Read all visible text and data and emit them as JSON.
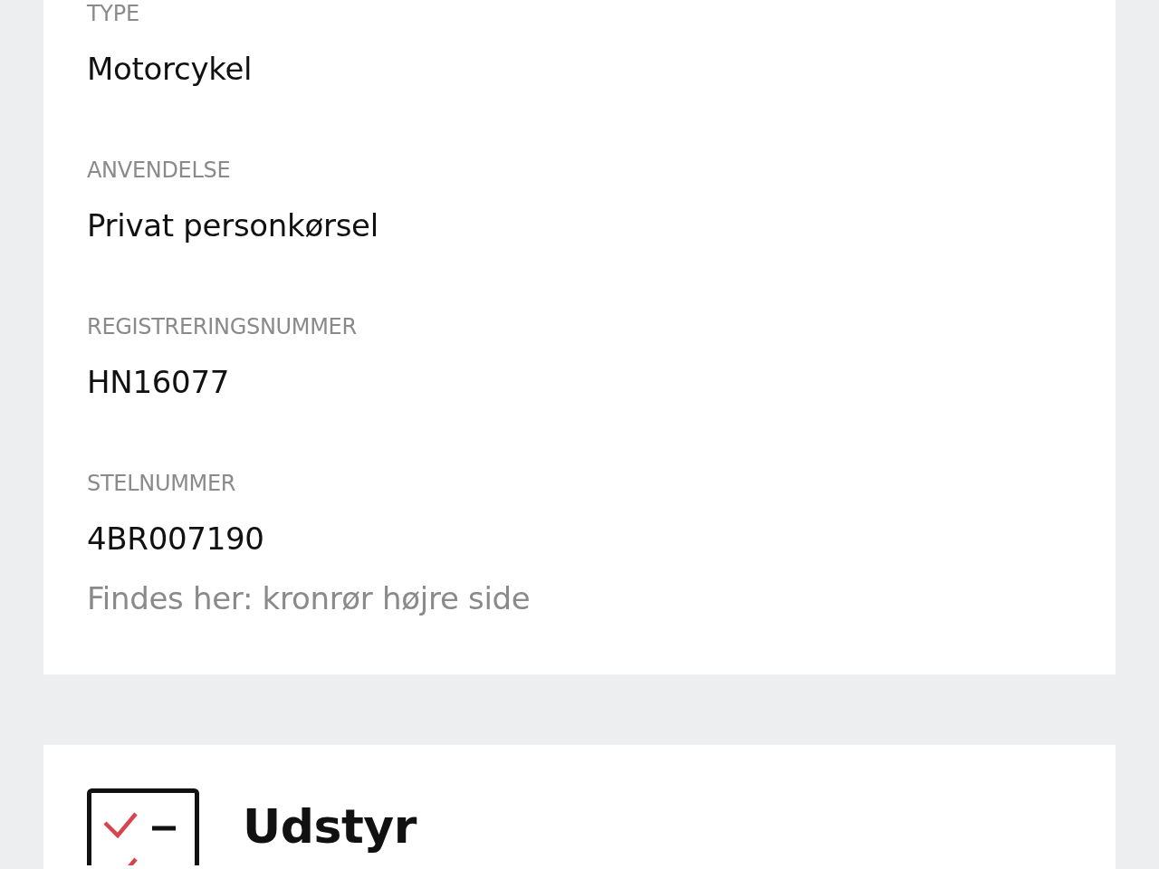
{
  "vehicle_card": {
    "fields": [
      {
        "label": "TYPE",
        "value": "Motorcykel"
      },
      {
        "label": "ANVENDELSE",
        "value": "Privat personkørsel"
      },
      {
        "label": "REGISTRERINGSNUMMER",
        "value": "HN16077"
      },
      {
        "label": "STELNUMMER",
        "value": "4BR007190",
        "note": "Findes her: kronrør højre side"
      }
    ]
  },
  "equipment_card": {
    "title": "Udstyr"
  }
}
